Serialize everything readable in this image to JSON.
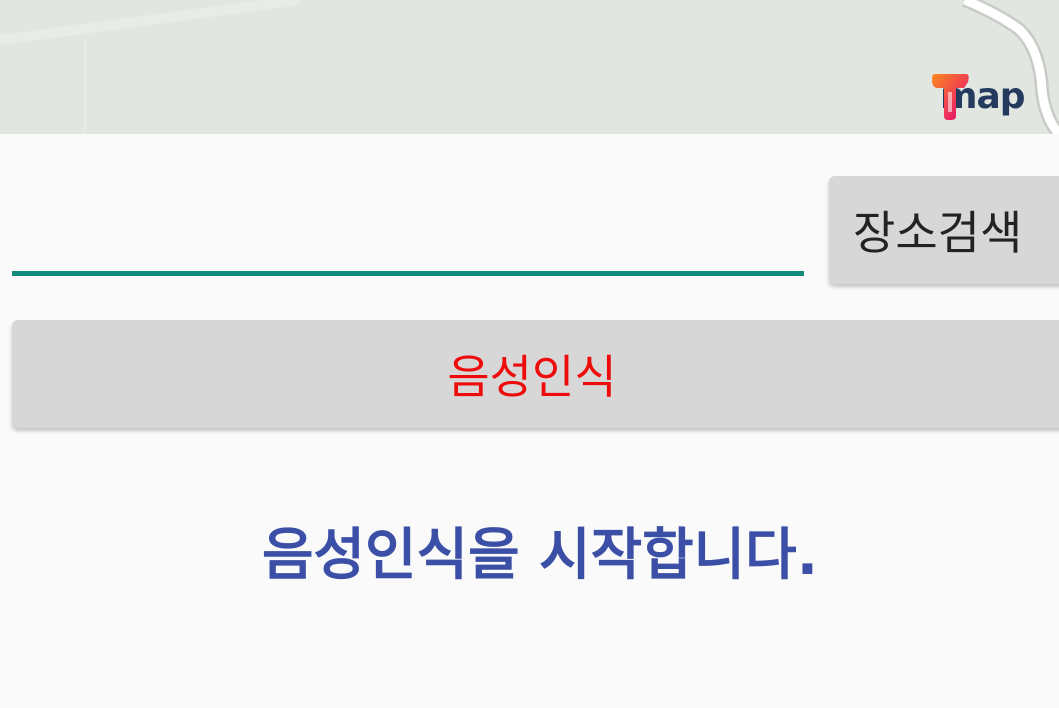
{
  "map": {
    "logo_text": "map",
    "logo_icon": "tmap-logo-icon"
  },
  "search": {
    "value": "",
    "placeholder": "",
    "button_label": "장소검색"
  },
  "voice": {
    "button_label": "음성인식"
  },
  "status": {
    "message": "음성인식을 시작합니다."
  },
  "colors": {
    "input_underline": "#138a7e",
    "voice_label": "#ee0b0b",
    "status_text": "#3b4fa6",
    "button_bg": "#d7d7d7"
  }
}
